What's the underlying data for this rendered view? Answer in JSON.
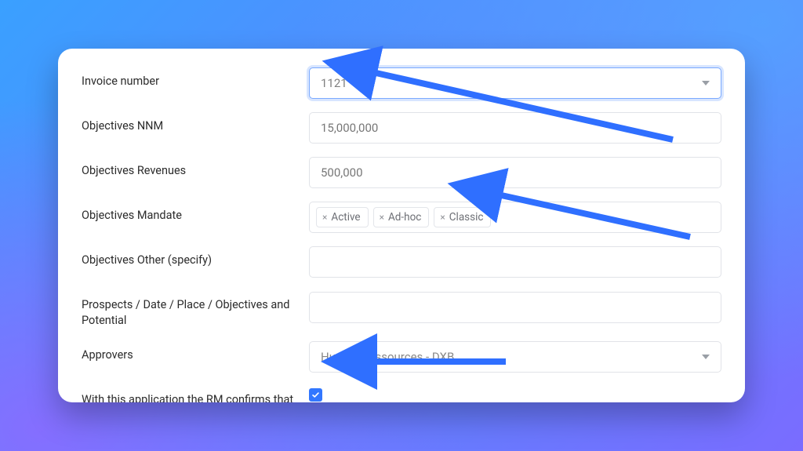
{
  "form": {
    "invoice_number": {
      "label": "Invoice number",
      "value": "1121"
    },
    "objectives_nnm": {
      "label": "Objectives NNM",
      "value": "15,000,000"
    },
    "objectives_revenues": {
      "label": "Objectives Revenues",
      "value": "500,000"
    },
    "objectives_mandate": {
      "label": "Objectives Mandate",
      "tags": [
        "Active",
        "Ad-hoc",
        "Classic"
      ]
    },
    "objectives_other": {
      "label": "Objectives Other (specify)",
      "value": ""
    },
    "prospects": {
      "label": "Prospects / Date / Place / Objectives and Potential",
      "value": ""
    },
    "approvers": {
      "label": "Approvers",
      "value": "Human Ressources - DXB"
    },
    "confirm": {
      "label": "With this application the RM confirms that the application is supported by the Eligibility for Travel",
      "checked": true
    }
  },
  "colors": {
    "arrow": "#2f6fff"
  }
}
